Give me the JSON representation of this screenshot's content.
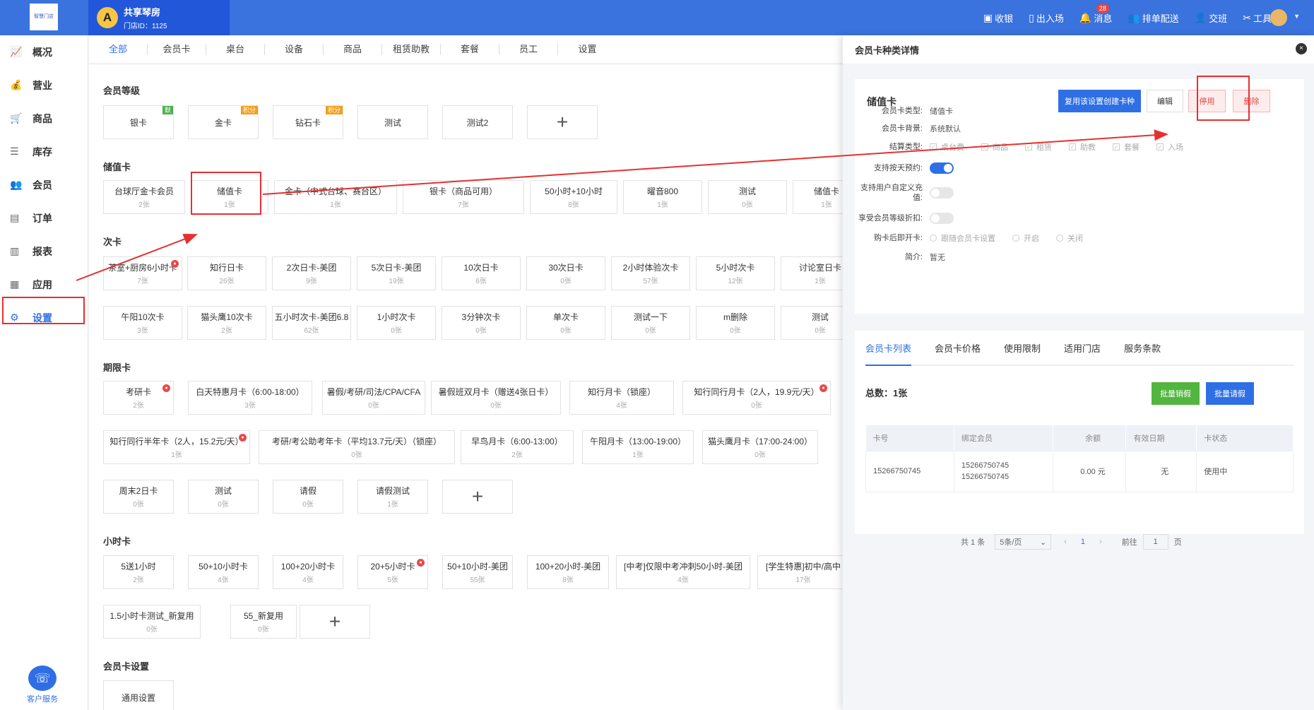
{
  "topbar": {
    "logo_text": "智慧门店",
    "shop_avatar": "A",
    "shop_name": "共享琴房",
    "shop_id": "门店ID：1125",
    "nav": [
      {
        "label": "收银",
        "icon": "cashier-icon",
        "glyph": "▣"
      },
      {
        "label": "出入场",
        "icon": "door-icon",
        "glyph": "▯"
      },
      {
        "label": "消息",
        "icon": "bell-icon",
        "glyph": "🔔",
        "badge": "28"
      },
      {
        "label": "排单配送",
        "icon": "users-icon",
        "glyph": "👥"
      },
      {
        "label": "交班",
        "icon": "handover-icon",
        "glyph": "👤"
      },
      {
        "label": "工具",
        "icon": "tools-icon",
        "glyph": "✂"
      }
    ]
  },
  "sidebar": {
    "items": [
      {
        "label": "概况",
        "glyph": "📈"
      },
      {
        "label": "营业",
        "glyph": "💰"
      },
      {
        "label": "商品",
        "glyph": "🛒"
      },
      {
        "label": "库存",
        "glyph": "☰"
      },
      {
        "label": "会员",
        "glyph": "👥"
      },
      {
        "label": "订单",
        "glyph": "▤"
      },
      {
        "label": "报表",
        "glyph": "▥"
      },
      {
        "label": "应用",
        "glyph": "▦"
      },
      {
        "label": "设置",
        "glyph": "⚙"
      }
    ],
    "service_label": "客户服务"
  },
  "tabs": [
    "全部",
    "会员卡",
    "桌台",
    "设备",
    "商品",
    "租赁助教",
    "套餐",
    "员工",
    "设置"
  ],
  "sections": {
    "levels": "会员等级",
    "stored": "储值卡",
    "times": "次卡",
    "period": "期限卡",
    "hour": "小时卡",
    "settings": "会员卡设置"
  },
  "level_cards": [
    {
      "name": "银卡",
      "tag": "默",
      "tag_color": "#4caf50"
    },
    {
      "name": "金卡",
      "tag": "积分",
      "tag_color": "#f0a020"
    },
    {
      "name": "钻石卡",
      "tag": "积分",
      "tag_color": "#f0a020"
    },
    {
      "name": "测试"
    },
    {
      "name": "测试2"
    }
  ],
  "stored_cards": [
    {
      "name": "台球厅金卡会员",
      "count": "2张"
    },
    {
      "name": "储值卡",
      "count": "1张"
    },
    {
      "name": "金卡（中式台球、赛台区）",
      "count": "1张"
    },
    {
      "name": "银卡（商品可用）",
      "count": "7张"
    },
    {
      "name": "50小时+10小时",
      "count": "8张"
    },
    {
      "name": "曜音800",
      "count": "1张"
    },
    {
      "name": "测试",
      "count": "0张"
    },
    {
      "name": "储值卡",
      "count": "1张"
    }
  ],
  "times_cards_row1": [
    {
      "name": "茶室+厨房6小时卡",
      "count": "7张",
      "lock": true
    },
    {
      "name": "知行日卡",
      "count": "26张"
    },
    {
      "name": "2次日卡-美团",
      "count": "9张"
    },
    {
      "name": "5次日卡-美团",
      "count": "19张"
    },
    {
      "name": "10次日卡",
      "count": "6张"
    },
    {
      "name": "30次日卡",
      "count": "0张"
    },
    {
      "name": "2小时体验次卡",
      "count": "57张"
    },
    {
      "name": "5小时次卡",
      "count": "12张"
    },
    {
      "name": "讨论室日卡",
      "count": "1张"
    }
  ],
  "times_cards_row2": [
    {
      "name": "午阳10次卡",
      "count": "3张"
    },
    {
      "name": "猫头鹰10次卡",
      "count": "2张"
    },
    {
      "name": "五小时次卡-美团6.8",
      "count": "62张"
    },
    {
      "name": "1小时次卡",
      "count": "0张"
    },
    {
      "name": "3分钟次卡",
      "count": "0张"
    },
    {
      "name": "单次卡",
      "count": "0张"
    },
    {
      "name": "测试一下",
      "count": "0张"
    },
    {
      "name": "m删除",
      "count": "0张"
    },
    {
      "name": "测试",
      "count": "0张"
    }
  ],
  "period_cards_row1": [
    {
      "name": "考研卡",
      "count": "2张",
      "lock": true
    },
    {
      "name": "白天特惠月卡（6:00-18:00）",
      "count": "3张"
    },
    {
      "name": "暑假/考研/司法/CPA/CFA",
      "count": "0张"
    },
    {
      "name": "暑假班双月卡（赠送4张日卡）",
      "count": "0张"
    },
    {
      "name": "知行月卡（锁座）",
      "count": "4张"
    },
    {
      "name": "知行同行月卡（2人，19.9元/天）",
      "count": "0张",
      "lock": true
    }
  ],
  "period_cards_row2": [
    {
      "name": "知行同行半年卡（2人，15.2元/天）",
      "count": "1张",
      "lock": true
    },
    {
      "name": "考研/考公助考年卡（平均13.7元/天）（锁座）",
      "count": "0张"
    },
    {
      "name": "早鸟月卡（6:00-13:00）",
      "count": "2张"
    },
    {
      "name": "午阳月卡（13:00-19:00）",
      "count": "1张"
    },
    {
      "name": "猫头鹰月卡（17:00-24:00）",
      "count": "0张"
    }
  ],
  "period_cards_row3": [
    {
      "name": "周末2日卡",
      "count": "0张"
    },
    {
      "name": "测试",
      "count": "0张"
    },
    {
      "name": "请假",
      "count": "0张"
    },
    {
      "name": "请假测试",
      "count": "1张"
    }
  ],
  "hour_cards_row1": [
    {
      "name": "5送1小时",
      "count": "2张"
    },
    {
      "name": "50+10小时卡",
      "count": "4张"
    },
    {
      "name": "100+20小时卡",
      "count": "4张"
    },
    {
      "name": "20+5小时卡",
      "count": "5张",
      "lock": true
    },
    {
      "name": "50+10小时-美团",
      "count": "55张"
    },
    {
      "name": "100+20小时-美团",
      "count": "8张"
    },
    {
      "name": "[中考]仅限中考冲刺50小时-美团",
      "count": "4张"
    },
    {
      "name": "[学生特惠]初中/高中",
      "count": "17张"
    }
  ],
  "hour_cards_row2": [
    {
      "name": "1.5小时卡测试_新复用",
      "count": "0张"
    },
    {
      "name": "55_新复用",
      "count": "0张"
    }
  ],
  "settings_cards": [
    {
      "name": "通用设置"
    }
  ],
  "plus": "+",
  "panel": {
    "title": "会员卡种类详情",
    "close": "×",
    "card_name": "储值卡",
    "buttons": {
      "reuse": "复用该设置创建卡种",
      "edit": "编辑",
      "disable": "停用",
      "delete": "删除"
    },
    "fields": {
      "type_label": "会员卡类型:",
      "type_value": "储值卡",
      "bg_label": "会员卡背景:",
      "bg_value": "系统默认",
      "settle_label": "结算类型:",
      "settle_options": [
        "桌台费",
        "商品",
        "租赁",
        "助教",
        "套餐",
        "入场"
      ],
      "book_label": "支持按天预约:",
      "custom_label": "支持用户自定义充值:",
      "discount_label": "享受会员等级折扣:",
      "open_label": "购卡后即开卡:",
      "open_options": [
        "跟随会员卡设置",
        "开启",
        "关闭"
      ],
      "intro_label": "简介:",
      "intro_value": "暂无"
    },
    "toggles": {
      "book": true,
      "custom": false,
      "discount": false
    },
    "tabs": [
      "会员卡列表",
      "会员卡价格",
      "使用限制",
      "适用门店",
      "服务条款"
    ],
    "total": "总数：1张",
    "batch_cancel": "批量销假",
    "batch_leave": "批量请假",
    "table": {
      "headers": [
        "卡号",
        "绑定会员",
        "余额",
        "有效日期",
        "卡状态"
      ],
      "rows": [
        {
          "card": "15266750745",
          "member1": "15266750745",
          "member2": "15266750745",
          "balance": "0.00 元",
          "valid": "无",
          "status": "使用中"
        }
      ]
    },
    "pager": {
      "total": "共 1 条",
      "size": "5条/页",
      "page": "1",
      "goto": "前往",
      "goto_val": "1",
      "unit": "页"
    }
  }
}
